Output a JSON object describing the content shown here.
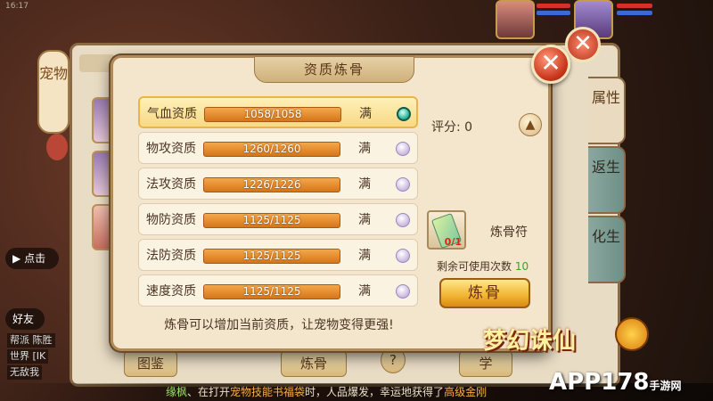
{
  "statusbar": {
    "time": "16:17"
  },
  "background_panel": {
    "left_tab": "宠物",
    "chips": {
      "play_prefix": "点击",
      "friends": "好友"
    },
    "chat_lines": [
      "帮派 陈胜",
      "世界 [IK",
      "无敌我"
    ],
    "buttons": {
      "illustration": "图鉴",
      "refine": "炼骨",
      "help": "?",
      "learn": "学"
    },
    "right_tabs": [
      "属性",
      "返生",
      "化生"
    ]
  },
  "dialog": {
    "title": "资质炼骨",
    "attributes": [
      {
        "name": "气血资质",
        "value": "1058/1058",
        "status": "满",
        "selected": true
      },
      {
        "name": "物攻资质",
        "value": "1260/1260",
        "status": "满",
        "selected": false
      },
      {
        "name": "法攻资质",
        "value": "1226/1226",
        "status": "满",
        "selected": false
      },
      {
        "name": "物防资质",
        "value": "1125/1125",
        "status": "满",
        "selected": false
      },
      {
        "name": "法防资质",
        "value": "1125/1125",
        "status": "满",
        "selected": false
      },
      {
        "name": "速度资质",
        "value": "1125/1125",
        "status": "满",
        "selected": false
      }
    ],
    "hint": "炼骨可以增加当前资质，让宠物变得更强!",
    "score_label": "评分:",
    "score_value": "0",
    "item": {
      "name": "炼骨符",
      "count": "0/1"
    },
    "remain_label": "剩余可使用次数",
    "remain_value": "10",
    "refine_button": "炼骨"
  },
  "announcement": {
    "name": "缘枫",
    "text1": "、在打开",
    "item": "宠物技能书福袋",
    "text2": "时，人品爆发，幸运地获得了",
    "reward": "高级金刚"
  },
  "branding": {
    "game_logo": "梦幻诛仙",
    "site": "APP178",
    "site_suffix": "手游网"
  },
  "colors": {
    "accent": "#f0b432",
    "selected_radio": "#3bb9a0",
    "remain_value": "#3aa520"
  }
}
